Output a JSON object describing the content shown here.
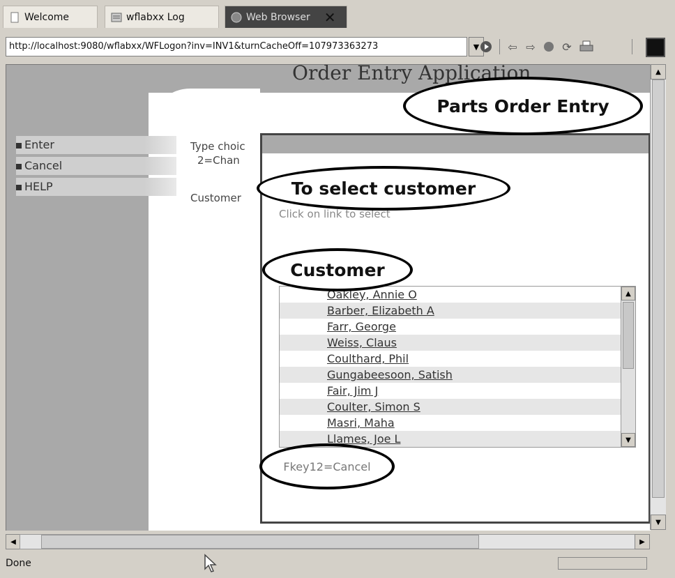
{
  "tabs": [
    {
      "label": "Welcome",
      "icon": "page-icon"
    },
    {
      "label": "wflabxx Log",
      "icon": "log-icon"
    },
    {
      "label": "Web Browser",
      "icon": "globe-icon",
      "active": true
    }
  ],
  "address": {
    "url": "http://localhost:9080/wflabxx/WFLogon?inv=INV1&turnCacheOff=107973363273"
  },
  "toolbar_icons": [
    "go-icon",
    "back-icon",
    "forward-icon",
    "stop-icon",
    "refresh-icon",
    "print-icon",
    "menu-icon"
  ],
  "page": {
    "app_title": "Order Entry Application",
    "nav": [
      "Enter",
      "Cancel",
      "HELP"
    ],
    "bg_text1": "Type choic",
    "bg_text2": "2=Chan",
    "bg_text3": "Customer"
  },
  "dialog": {
    "hint": "Click on link to select",
    "customers": [
      "Oakley, Annie O",
      "Barber, Elizabeth A",
      "Farr, George",
      "Weiss, Claus",
      "Coulthard, Phil",
      "Gungabeesoon, Satish",
      "Fair, Jim J",
      "Coulter, Simon S",
      "Masri, Maha",
      "Llames, Joe L"
    ],
    "fkey": "Fkey12=Cancel"
  },
  "annotations": {
    "parts_order_entry": "Parts Order Entry",
    "select_customer": "To select customer",
    "customer": "Customer"
  },
  "status": {
    "text": "Done"
  }
}
